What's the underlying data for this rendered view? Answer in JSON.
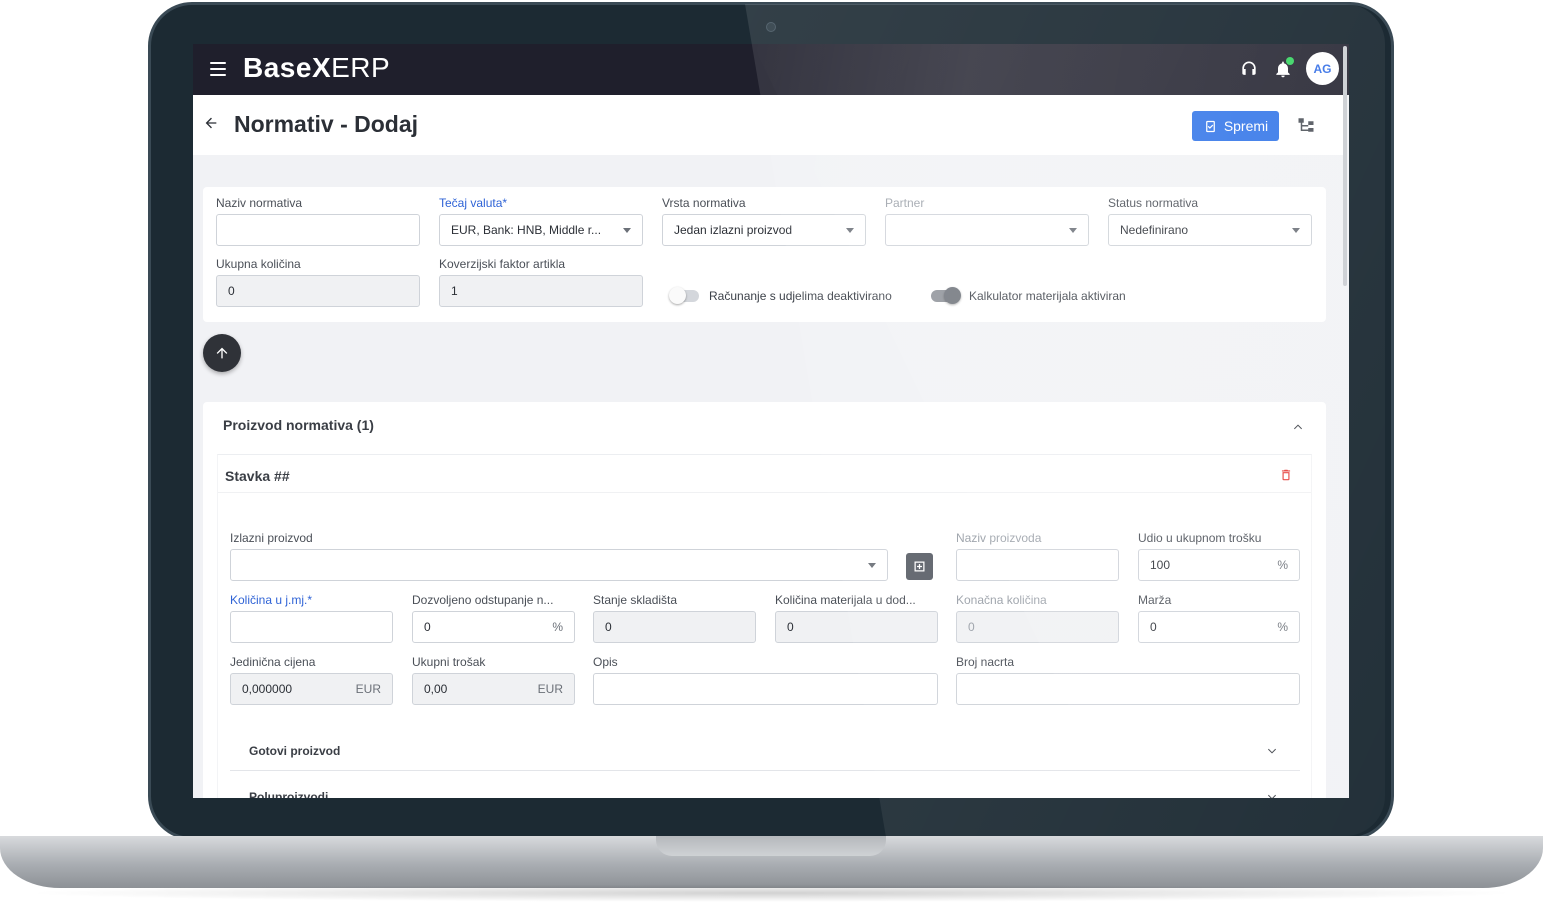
{
  "app": {
    "logo_bold": "BaseX",
    "logo_light": "ERP",
    "avatar_initials": "AG"
  },
  "header": {
    "title": "Normativ - Dodaj",
    "save_label": "Spremi"
  },
  "form": {
    "naziv": {
      "label": "Naziv normativa",
      "value": ""
    },
    "tecaj": {
      "label": "Tečaj valuta*",
      "value": "EUR, Bank: HNB, Middle r..."
    },
    "vrsta": {
      "label": "Vrsta normativa",
      "value": "Jedan izlazni proizvod"
    },
    "partner": {
      "label": "Partner",
      "value": ""
    },
    "status": {
      "label": "Status normativa",
      "value": "Nedefinirano"
    },
    "ukupna": {
      "label": "Ukupna količina",
      "value": "0"
    },
    "faktor": {
      "label": "Koverzijski faktor artikla",
      "value": "1"
    },
    "toggle_udjeli": {
      "label": "Računanje s udjelima deaktivirano",
      "on": false
    },
    "toggle_kalkulator": {
      "label": "Kalkulator materijala aktiviran",
      "on": true
    }
  },
  "products": {
    "section_title": "Proizvod normativa (1)",
    "item_title": "Stavka ##",
    "izlazni": {
      "label": "Izlazni proizvod",
      "value": ""
    },
    "naziv_proizvoda": {
      "label": "Naziv proizvoda",
      "value": ""
    },
    "udio": {
      "label": "Udio u ukupnom trošku",
      "value": "100",
      "suffix": "%"
    },
    "kolicina": {
      "label": "Količina u j.mj.*",
      "value": ""
    },
    "odstupanje": {
      "label": "Dozvoljeno odstupanje n...",
      "value": "0",
      "suffix": "%"
    },
    "stanje": {
      "label": "Stanje skladišta",
      "value": "0"
    },
    "kol_materijala": {
      "label": "Količina materijala u dod...",
      "value": "0"
    },
    "konacna": {
      "label": "Konačna količina",
      "value": "0"
    },
    "marza": {
      "label": "Marža",
      "value": "0",
      "suffix": "%"
    },
    "jed_cijena": {
      "label": "Jedinična cijena",
      "value": "0,000000",
      "suffix": "EUR"
    },
    "ukupni_trosak": {
      "label": "Ukupni trošak",
      "value": "0,00",
      "suffix": "EUR"
    },
    "opis": {
      "label": "Opis",
      "value": ""
    },
    "broj_nacrta": {
      "label": "Broj nacrta",
      "value": ""
    },
    "gotovi": {
      "label": "Gotovi proizvod"
    },
    "poluproizvodi": {
      "label": "Poluproizvodi"
    }
  },
  "colors": {
    "primary": "#2f73e8",
    "topbar": "#1f1f2c",
    "required_label": "#2f63d6",
    "danger": "#e53935",
    "status_online": "#2fd35b"
  },
  "icons": [
    "menu-icon",
    "headset-icon",
    "bell-icon",
    "arrow-back-icon",
    "save-icon",
    "hierarchy-icon",
    "arrow-up-icon",
    "chevron-up-icon",
    "chevron-down-icon",
    "trash-icon",
    "plus-box-icon"
  ]
}
